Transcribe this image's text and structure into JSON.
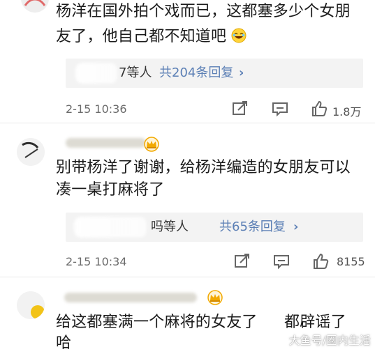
{
  "comments": [
    {
      "text_line1": "杨洋在国外拍个戏而已，这都塞多少个女朋",
      "text_line2": "友了，他自己都不知道吧",
      "reply_prefix": "7等人",
      "reply_count": "共204条回复",
      "time": "2-15 10:36",
      "likes": "1.8万"
    },
    {
      "text_line1": "别带杨洋了谢谢，给杨洋编造的女朋友可以",
      "text_line2": "凑一桌打麻将了",
      "reply_prefix": "吗等人",
      "reply_count": "共65条回复",
      "time": "2-15 10:34",
      "likes": "8155"
    },
    {
      "text_line1": "给这都塞满一个麻将的女友了",
      "text_line1b": "都辟谣了",
      "text_line2": "哈"
    }
  ],
  "icons": {
    "share": "share-icon",
    "comment": "comment-icon",
    "like": "like-icon",
    "crown": "crown-badge-icon",
    "emoji": "laughing-emoji-icon"
  },
  "watermark": "大鱼号/圈内生活",
  "colors": {
    "link": "#5b7fb5",
    "reply_bg": "#f3f3f3",
    "crown": "#f2a900"
  }
}
